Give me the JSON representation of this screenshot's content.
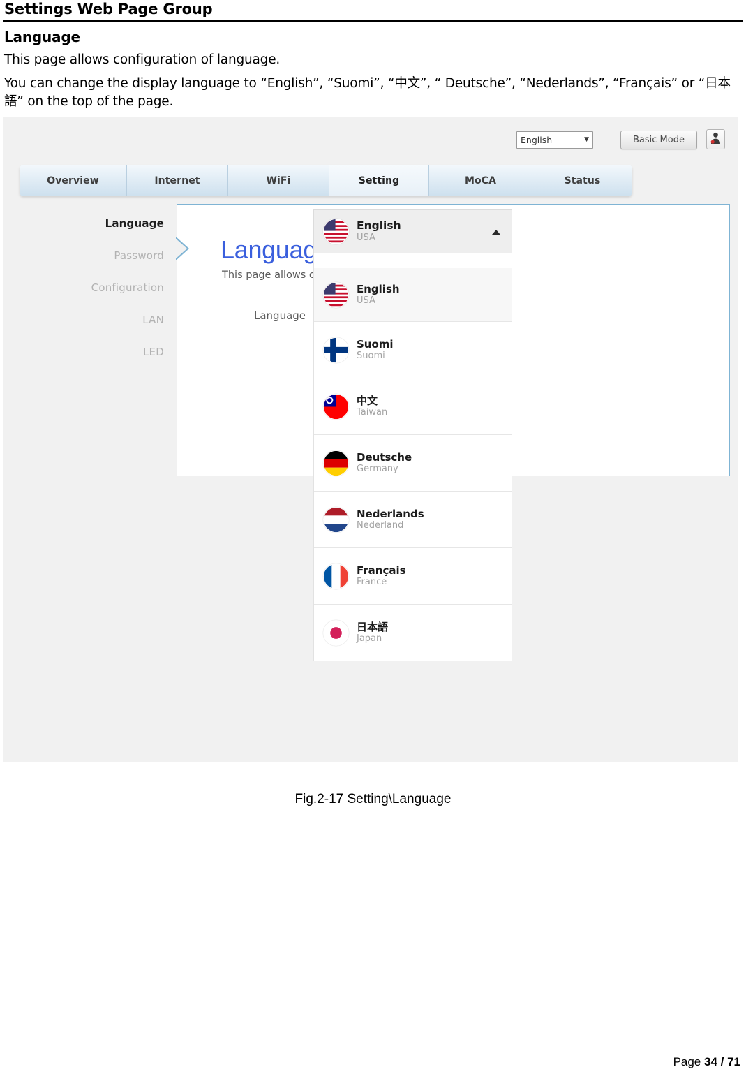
{
  "document": {
    "running_header": "Settings Web Page Group",
    "section_title": "Language",
    "paragraph_1": "This page allows configuration of language.",
    "paragraph_2": "You can change the display language to “English”, “Suomi”, “中文”, “ Deutsche”, “Nederlands”, “Français” or “日本語” on the top of the page.",
    "figure_caption": "Fig.2-17 Setting\\Language",
    "footer_prefix": "Page ",
    "footer_page": "34 / 71"
  },
  "screenshot": {
    "topbar": {
      "language_select_value": "English",
      "language_select_caret": "▼",
      "basic_mode_label": "Basic Mode",
      "user_icon_name": "user-account-icon"
    },
    "tabs": [
      {
        "label": "Overview",
        "active": false
      },
      {
        "label": "Internet",
        "active": false
      },
      {
        "label": "WiFi",
        "active": false
      },
      {
        "label": "Setting",
        "active": true
      },
      {
        "label": "MoCA",
        "active": false
      },
      {
        "label": "Status",
        "active": false
      }
    ],
    "sidebar": {
      "items": [
        {
          "label": "Language",
          "active": true
        },
        {
          "label": "Password",
          "active": false
        },
        {
          "label": "Configuration",
          "active": false
        },
        {
          "label": "LAN",
          "active": false
        },
        {
          "label": "LED",
          "active": false
        }
      ]
    },
    "panel": {
      "title": "Language",
      "subtitle": "This page allows configuration of multi language.",
      "form_label": "Language"
    },
    "dropdown": {
      "selected": {
        "name": "English",
        "country": "USA",
        "flag": "us-flag-icon"
      },
      "expanded": true,
      "options": [
        {
          "name": "English",
          "country": "USA",
          "flag": "us-flag-icon"
        },
        {
          "name": "Suomi",
          "country": "Suomi",
          "flag": "fi-flag-icon"
        },
        {
          "name": "中文",
          "country": "Taiwan",
          "flag": "tw-flag-icon"
        },
        {
          "name": "Deutsche",
          "country": "Germany",
          "flag": "de-flag-icon"
        },
        {
          "name": "Nederlands",
          "country": "Nederland",
          "flag": "nl-flag-icon"
        },
        {
          "name": "Français",
          "country": "France",
          "flag": "fr-flag-icon"
        },
        {
          "name": "日本語",
          "country": "Japan",
          "flag": "jp-flag-icon"
        }
      ]
    },
    "colors": {
      "panel_border": "#7fb4d4",
      "panel_title": "#3a5fdd",
      "page_bg": "#f1f1f1",
      "tab_active": "#e7f0f7"
    }
  }
}
